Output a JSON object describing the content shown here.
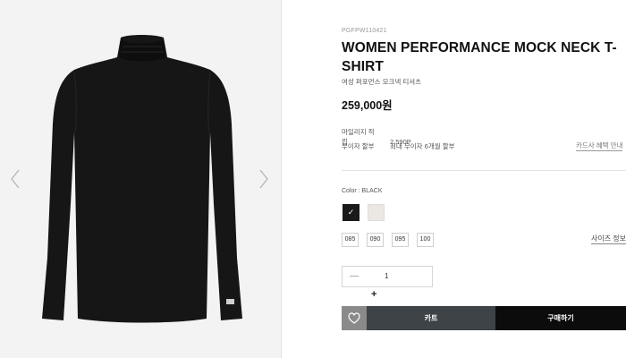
{
  "product": {
    "code": "PGFPW110421",
    "title": "WOMEN PERFORMANCE MOCK NECK T-SHIRT",
    "subtitle": "여성 퍼포먼스 모크넥 티셔츠",
    "price": "259,000원"
  },
  "info": {
    "mileage_label": "마일리지 적립",
    "mileage_value": "2,590P",
    "installment_label": "무이자 할부",
    "installment_value": "최대 무이자 6개월 할부",
    "card_benefit_link": "카드사 혜택 안내"
  },
  "options": {
    "color_label": "Color : BLACK",
    "selected_mark": "✓",
    "sizes": [
      "085",
      "090",
      "095",
      "100"
    ],
    "size_guide_link": "사이즈 정보"
  },
  "quantity": {
    "minus": "—",
    "value": "1",
    "plus": "+"
  },
  "actions": {
    "cart": "카트",
    "buy": "구매하기"
  },
  "colors": {
    "swatch_black": "#1a1a1a",
    "swatch_white": "#ebe8e3",
    "cart_button": "#3d4347",
    "buy_button": "#0c0c0c",
    "wishlist_button": "#8a8a8a"
  },
  "icons": {
    "prev": "chevron-left-icon",
    "next": "chevron-right-icon",
    "wishlist": "heart-icon",
    "check": "check-icon"
  }
}
